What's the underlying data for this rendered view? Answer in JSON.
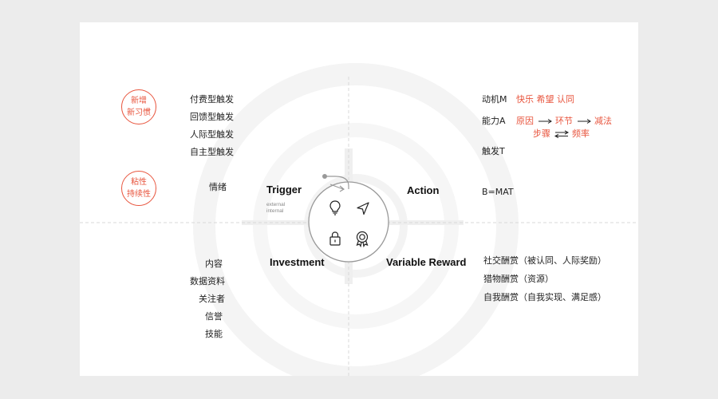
{
  "quadrants": {
    "trigger": "Trigger",
    "action": "Action",
    "investment": "Investment",
    "reward": "Variable Reward"
  },
  "trigger_types": [
    "external",
    "internal"
  ],
  "badges": {
    "new_habit": [
      "新增",
      "新习惯"
    ],
    "stickiness": [
      "粘性",
      "持续性"
    ]
  },
  "trigger_list": [
    "付费型触发",
    "回馈型触发",
    "人际型触发",
    "自主型触发"
  ],
  "emotion": "情绪",
  "investment_list": [
    "内容",
    "数据资料",
    "关注者",
    "信誉",
    "技能"
  ],
  "action_panel": {
    "motivation_label": "动机M",
    "motivation_items": "快乐 希望 认同",
    "ability_label": "能力A",
    "ability_from": "原因",
    "ability_mid": "环节",
    "ability_to": "减法",
    "ability_sub_from": "步骤",
    "ability_sub_to": "频率",
    "trigger_label": "触发T",
    "formula": "B=MAT"
  },
  "reward_list": [
    "社交酬赏（被认同、人际奖励）",
    "猎物酬赏（资源）",
    "自我酬赏（自我实现、满足感）"
  ],
  "icons": {
    "trigger": "lightbulb-icon",
    "action": "navigation-arrow-icon",
    "investment": "lock-icon",
    "reward": "award-medal-icon"
  },
  "colors": {
    "accent": "#e8553e",
    "text": "#222222",
    "muted": "#888888"
  }
}
